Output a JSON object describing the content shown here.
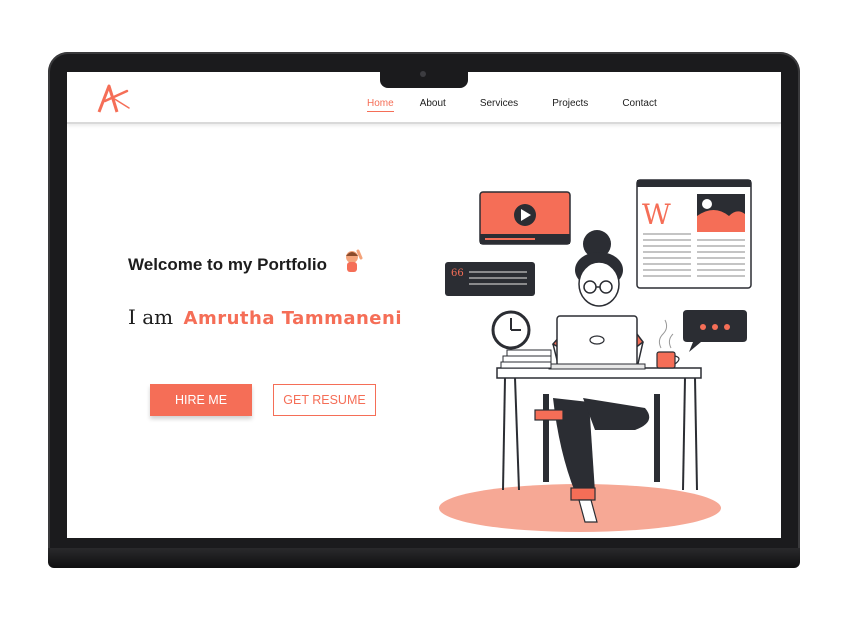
{
  "nav": {
    "items": [
      {
        "label": "Home",
        "active": true
      },
      {
        "label": "About",
        "active": false
      },
      {
        "label": "Services",
        "active": false
      },
      {
        "label": "Projects",
        "active": false
      },
      {
        "label": "Contact",
        "active": false
      }
    ]
  },
  "hero": {
    "welcome": "Welcome to my Portfolio",
    "intro_prefix": "I am",
    "name": "Amrutha Tammaneni",
    "hire_button": "HIRE ME",
    "resume_button": "GET RESUME"
  },
  "illustration": {
    "wiki_letter": "W"
  },
  "colors": {
    "accent": "#f56e57",
    "dark": "#2b2d33",
    "text": "#1d1d1d"
  }
}
